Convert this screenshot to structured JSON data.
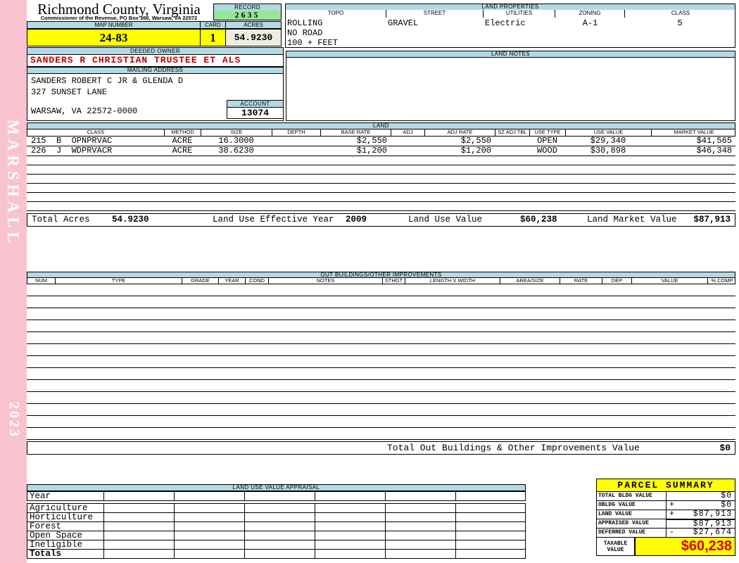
{
  "sidebar": {
    "vendor": "MARSHALL",
    "year": "2023"
  },
  "card_header": {
    "county": "Richmond County, Virginia",
    "commissioner_line": "Commissioner of the Revenue, PO Box 366, Warsaw, VA 22572",
    "record_label": "RECORD",
    "record_value": "2635",
    "map_number_label": "MAP NUMBER",
    "map_number": "24-83",
    "card_label": "CARD",
    "card_number": "1",
    "acres_label": "ACRES",
    "acres": "54.9230"
  },
  "land_properties": {
    "title": "LAND PROPERTIES",
    "columns": [
      "TOPO",
      "STREET",
      "UTILITIES",
      "ZONING",
      "CLASS"
    ],
    "topo_lines": [
      "ROLLING",
      "NO ROAD",
      "100 + FEET"
    ],
    "street": "GRAVEL",
    "utilities": "Electric",
    "zoning": "A-1",
    "class": "5"
  },
  "owner": {
    "deeded_owner_label": "DEEDED OWNER",
    "deeded_owner": "SANDERS R CHRISTIAN TRUSTEE ET ALS",
    "mailing_address_label": "MAILING ADDRESS",
    "address_lines": [
      "SANDERS ROBERT C JR & GLENDA D",
      "327 SUNSET LANE",
      "WARSAW, VA 22572-0000"
    ],
    "account_label": "ACCOUNT",
    "account_number": "13074"
  },
  "land_notes": {
    "title": "LAND NOTES",
    "text": ""
  },
  "land": {
    "title": "LAND",
    "columns": [
      "CLASS",
      "METHOD",
      "SIZE",
      "DEPTH",
      "BASE RATE",
      "ADJ",
      "ADJ RATE",
      "SZ ADJ TBL",
      "USE TYPE",
      "USE VALUE",
      "MARKET VALUE"
    ],
    "rows": [
      [
        "215  B  OPNPRVAC",
        "ACRE",
        "16.3000",
        "",
        "$2,550",
        "",
        "$2,550",
        "",
        "OPEN",
        "$29,340",
        "$41,565"
      ],
      [
        "226  J  WDPRVACR",
        "ACRE",
        "38.6230",
        "",
        "$1,200",
        "",
        "$1,200",
        "",
        "WOOD",
        "$30,898",
        "$46,348"
      ]
    ],
    "totals": {
      "total_acres_label": "Total Acres",
      "total_acres": "54.9230",
      "effective_year_label": "Land Use Effective Year",
      "effective_year": "2009",
      "use_value_label": "Land Use Value",
      "use_value": "$60,238",
      "market_value_label": "Land Market Value",
      "market_value": "$87,913"
    }
  },
  "out_buildings": {
    "title": "OUT BUILDINGS/OTHER IMPROVEMENTS",
    "columns": [
      "NUM",
      "TYPE",
      "GRADE",
      "YEAR",
      "COND",
      "NOTES",
      "STHGT",
      "LENGTH X WIDTH",
      "AREA/SIZE",
      "RATE",
      "DEP",
      "VALUE",
      "% COMP"
    ],
    "total_label": "Total Out Buildings & Other Improvements Value",
    "total_value": "$0"
  },
  "land_use_appraisal": {
    "title": "LAND USE VALUE APPRAISAL",
    "row_labels": [
      "Year",
      "Agriculture",
      "Horticulture",
      "Forest",
      "Open Space",
      "Ineligible",
      "Totals"
    ]
  },
  "parcel_summary": {
    "title": "PARCEL SUMMARY",
    "rows": [
      {
        "label": "TOTAL BLDG VALUE",
        "op": "",
        "value": "$0"
      },
      {
        "label": "OBLDG VALUE",
        "op": "+",
        "value": "$0"
      },
      {
        "label": "LAND VALUE",
        "op": "+",
        "value": "$87,913"
      },
      {
        "label": "APPRAISED VALUE",
        "op": "",
        "value": "$87,913"
      },
      {
        "label": "DEFERRED VALUE",
        "op": "-",
        "value": "$27,674"
      }
    ],
    "taxable_label": "TAXABLE VALUE",
    "taxable_value": "$60,238"
  },
  "colors": {
    "sidebar_pink": "#F8C3CE",
    "header_blue": "#B3D9E5",
    "record_green": "#98E698",
    "highlight_yellow": "#FFFF00",
    "acres_beige": "#EEEEDE",
    "owner_red": "#C00000",
    "taxable_red": "#DD0000"
  }
}
